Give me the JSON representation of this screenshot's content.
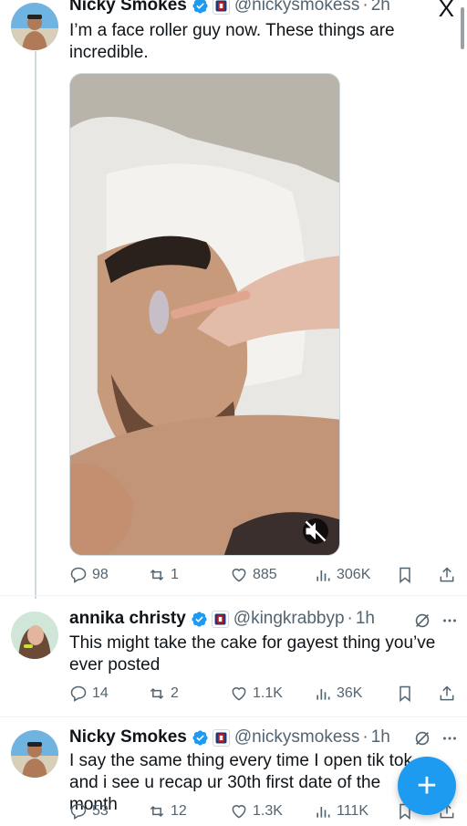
{
  "tweets": [
    {
      "name": "Nicky Smokes",
      "handle": "@nickysmokess",
      "time": "2h",
      "text": "I’m a face roller guy now. These things are incredible.",
      "stats": {
        "replies": "98",
        "reposts": "1",
        "likes": "885",
        "views": "306K"
      }
    },
    {
      "name": "annika christy",
      "handle": "@kingkrabbyp",
      "time": "1h",
      "text": "This might take the cake for gayest thing you’ve ever posted",
      "stats": {
        "replies": "14",
        "reposts": "2",
        "likes": "1.1K",
        "views": "36K"
      }
    },
    {
      "name": "Nicky Smokes",
      "handle": "@nickysmokess",
      "time": "1h",
      "text": "I say the same thing every time I open tik tok and i see u recap ur 30th first date of the month",
      "stats": {
        "replies": "53",
        "reposts": "12",
        "likes": "1.3K",
        "views": "111K"
      }
    }
  ],
  "icons": {
    "close": "x-close-icon",
    "verified": "verified-badge-icon",
    "affiliate": "affiliate-badge-icon",
    "reply": "reply-icon",
    "repost": "repost-icon",
    "like": "heart-icon",
    "views": "views-icon",
    "bookmark": "bookmark-icon",
    "share": "share-icon",
    "grok": "grok-icon",
    "more": "more-icon",
    "mute": "mute-icon",
    "compose": "compose-icon"
  },
  "colors": {
    "accent": "#1d9bf0",
    "text": "#0f1419",
    "muted": "#536471"
  },
  "close_label": "X",
  "compose_label": "+"
}
